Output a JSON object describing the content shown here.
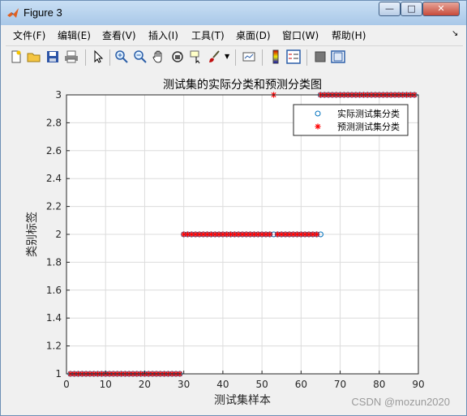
{
  "window": {
    "title": "Figure 3"
  },
  "menu": {
    "items": [
      {
        "label": "文件(F)"
      },
      {
        "label": "编辑(E)"
      },
      {
        "label": "查看(V)"
      },
      {
        "label": "插入(I)"
      },
      {
        "label": "工具(T)"
      },
      {
        "label": "桌面(D)"
      },
      {
        "label": "窗口(W)"
      },
      {
        "label": "帮助(H)"
      }
    ]
  },
  "toolbar": {
    "icons": [
      "new-figure-icon",
      "open-icon",
      "save-icon",
      "print-icon",
      "pointer-icon",
      "zoom-in-icon",
      "zoom-out-icon",
      "pan-icon",
      "rotate-icon",
      "data-cursor-icon",
      "brush-icon",
      "brush-dropdown-icon",
      "link-plot-icon",
      "colorbar-icon",
      "legend-icon",
      "hide-plot-tools-icon",
      "show-plot-tools-icon"
    ]
  },
  "chart_data": {
    "type": "scatter",
    "title": "测试集的实际分类和预测分类图",
    "xlabel": "测试集样本",
    "ylabel": "类别标签",
    "xlim": [
      0,
      90
    ],
    "ylim": [
      1,
      3
    ],
    "xticks": [
      "0",
      "10",
      "20",
      "30",
      "40",
      "50",
      "60",
      "70",
      "80",
      "90"
    ],
    "yticks": [
      "1",
      "1.2",
      "1.4",
      "1.6",
      "1.8",
      "2",
      "2.2",
      "2.4",
      "2.6",
      "2.8",
      "3"
    ],
    "grid": true,
    "legend_position": "top-right",
    "series": [
      {
        "name": "实际测试集分类",
        "marker": "o",
        "color": "#0072bd",
        "segments": [
          {
            "x_start": 1,
            "x_end": 29,
            "y": 1
          },
          {
            "x_start": 30,
            "x_end": 65,
            "y": 2
          },
          {
            "x_start": 65,
            "x_end": 89,
            "y": 3
          }
        ]
      },
      {
        "name": "预测测试集分类",
        "marker": "*",
        "color": "#ff0000",
        "segments": [
          {
            "x_start": 1,
            "x_end": 29,
            "y": 1
          },
          {
            "x_start": 30,
            "x_end": 52,
            "y": 2
          },
          {
            "x_start": 54,
            "x_end": 64,
            "y": 2
          },
          {
            "x_start": 53,
            "x_end": 53,
            "y": 3
          },
          {
            "x_start": 65,
            "x_end": 89,
            "y": 3
          }
        ]
      }
    ]
  },
  "watermark": "CSDN @mozun2020"
}
